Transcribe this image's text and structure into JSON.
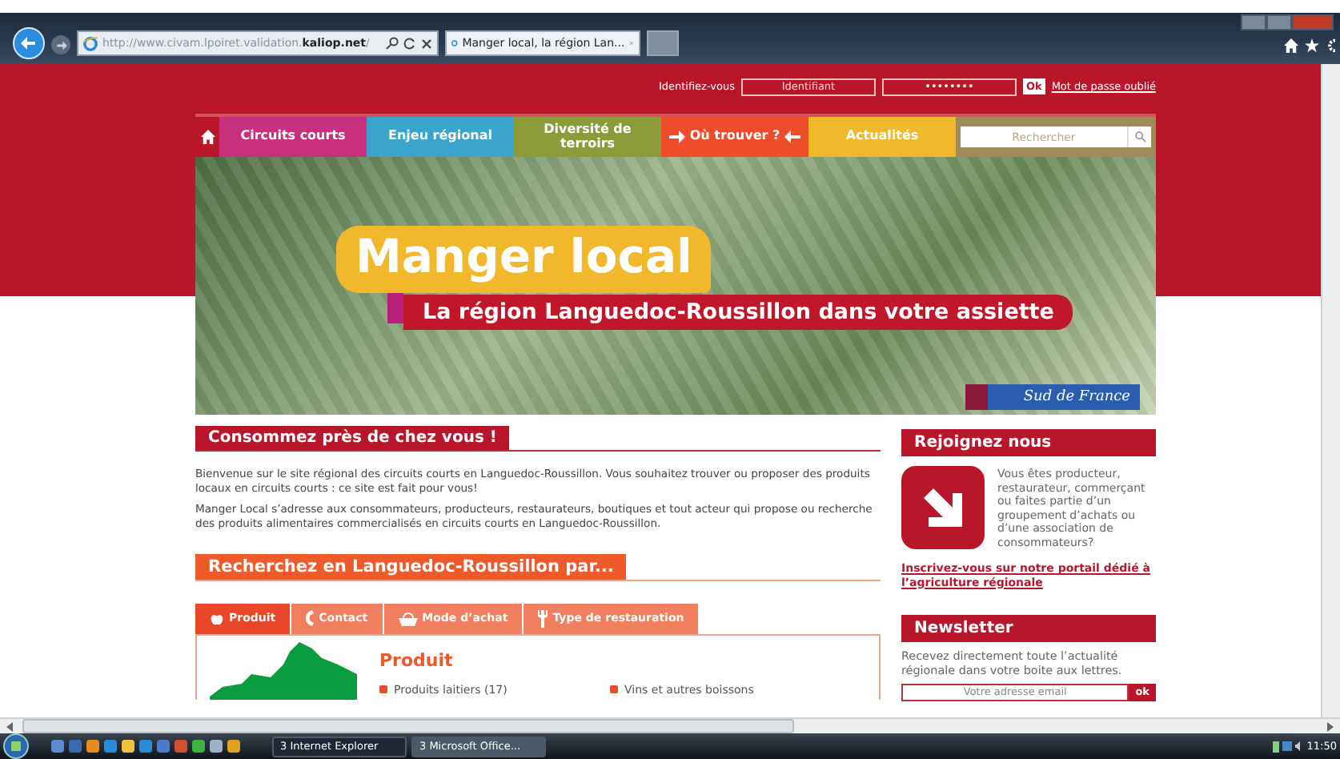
{
  "browser": {
    "address": "http://www.civam.lpoiret.validation.**kaliop.net**/",
    "tabs": [
      {
        "title": "Manger local, la région Lan...",
        "selected": true
      }
    ]
  },
  "login": {
    "label": "Identifiez-vous",
    "username_placeholder": "Identifiant",
    "password_value": "••••••••",
    "submit": "Ok",
    "forgot_link": "Mot de passe oublié"
  },
  "nav": {
    "items": [
      {
        "label": "Circuits courts",
        "color": "#c8307e",
        "kind": "plain"
      },
      {
        "label": "Enjeu régional",
        "color": "#3ba4cc",
        "kind": "plain"
      },
      {
        "label": "Diversité de terroirs",
        "color": "#8d9a3a",
        "kind": "plain"
      },
      {
        "label": "Où trouver ?",
        "color": "#ee4c2a",
        "kind": "arrows"
      },
      {
        "label": "Actualités",
        "color": "#f0b82a",
        "kind": "plain"
      }
    ],
    "search_placeholder": "Rechercher"
  },
  "banner": {
    "title": "Manger local",
    "subtitle": "La région Languedoc-Roussillon dans votre assiette",
    "logo": "Sud de France"
  },
  "intro": {
    "heading": "Consommez près de chez vous !",
    "paragraphs": [
      "Bienvenue sur le site régional des circuits courts en Languedoc-Roussillon. Vous souhaitez trouver ou proposer des produits locaux en circuits courts : ce site est fait pour vous!",
      "Manger Local s’adresse aux consommateurs, producteurs, restaurateurs, boutiques et tout acteur qui propose ou recherche des produits alimentaires commercialisés en circuits courts en Languedoc-Roussillon."
    ]
  },
  "search_by": {
    "heading": "Recherchez en Languedoc-Roussillon par...",
    "tabs": [
      {
        "label": "Produit",
        "kind": "apple",
        "selected": true
      },
      {
        "label": "Contact",
        "kind": "phone",
        "selected": false
      },
      {
        "label": "Mode d’achat",
        "kind": "basket",
        "selected": false
      },
      {
        "label": "Type de restauration",
        "kind": "fork",
        "selected": false
      }
    ],
    "panel_title": "Produit",
    "items": [
      "Produits laitiers (17)",
      "Vins et autres boissons"
    ]
  },
  "join": {
    "heading": "Rejoignez nous",
    "text": "Vous êtes producteur, restaurateur, commerçant ou faites partie d’un groupement d’achats ou d’une association de consommateurs?",
    "link": "Inscrivez-vous sur notre portail dédié à l’agriculture régionale"
  },
  "newsletter": {
    "heading": "Newsletter",
    "text": "Recevez directement toute l’actualité régionale dans votre boite aux lettres.",
    "email_placeholder": "Votre adresse email",
    "submit": "ok"
  },
  "taskbar": {
    "tasks": [
      {
        "label": "3 Internet Explorer",
        "selected": true
      },
      {
        "label": "3 Microsoft Office...",
        "selected": false
      }
    ],
    "clock": "11:50"
  }
}
